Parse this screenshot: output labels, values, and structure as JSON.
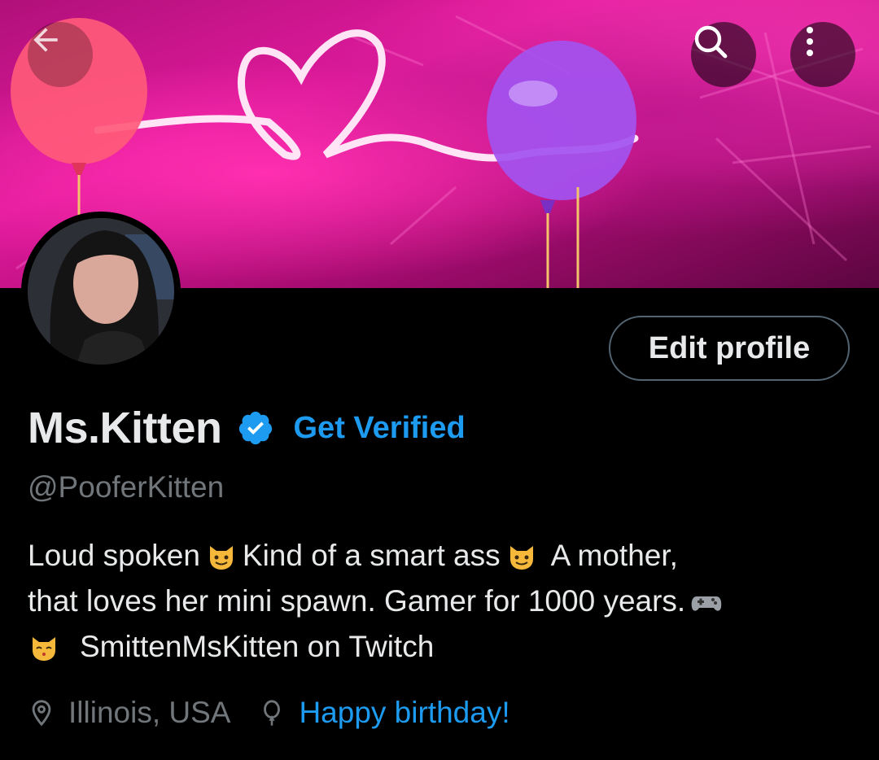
{
  "header": {
    "back_icon": "arrow-left-icon",
    "search_icon": "search-icon",
    "more_icon": "more-vertical-icon"
  },
  "profile": {
    "display_name": "Ms.Kitten",
    "get_verified_label": "Get Verified",
    "handle": "@PooferKitten",
    "edit_profile_label": "Edit profile",
    "bio": {
      "line1_a": "Loud spoken",
      "line1_b": "Kind of a smart ass",
      "line1_c": "A mother,",
      "line2": "that loves her mini spawn.  Gamer for 1000 years.",
      "line3": "SmittenMsKitten on Twitch"
    },
    "location": "Illinois, USA",
    "birthday": "Happy birthday!"
  },
  "colors": {
    "accent": "#1d9bf0",
    "muted": "#71767b",
    "text": "#e7e9ea",
    "background": "#000000"
  }
}
